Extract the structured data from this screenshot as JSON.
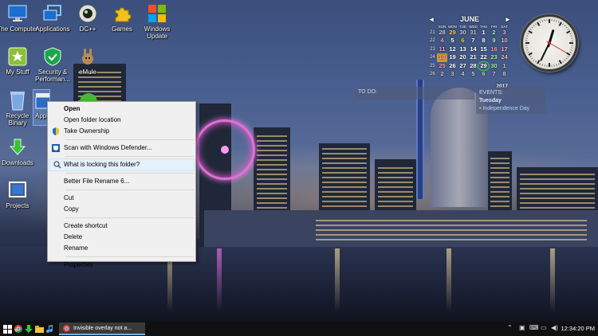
{
  "desktop_icons": [
    {
      "label": "The Computer",
      "icon": "computer-icon"
    },
    {
      "label": "Applications",
      "icon": "windows-folder-icon"
    },
    {
      "label": "DC++",
      "icon": "dcpp-icon"
    },
    {
      "label": "Games",
      "icon": "puzzle-icon"
    },
    {
      "label": "Windows Update",
      "icon": "windows-update-icon"
    },
    {
      "label": "My Stuff",
      "icon": "star-folder-icon"
    },
    {
      "label": "Security & Performan...",
      "icon": "shield-check-icon"
    },
    {
      "label": "eMule",
      "icon": "emule-mule-icon"
    },
    {
      "label": "Recycle Binary",
      "icon": "recycle-bin-icon"
    },
    {
      "label": "Appl",
      "icon": "clapper-icon"
    },
    {
      "label": "Downloads",
      "icon": "download-arrow-icon"
    },
    {
      "label": "Projects",
      "icon": "projects-icon"
    }
  ],
  "calendar": {
    "month": "JUNE",
    "year": "2017",
    "weekdays": [
      "SUN",
      "MON",
      "TUE",
      "WED",
      "THU",
      "FRI",
      "SAT"
    ],
    "weeks": [
      [
        "28",
        "29",
        "30",
        "31",
        "1",
        "2",
        "3"
      ],
      [
        "4",
        "5",
        "6",
        "7",
        "8",
        "9",
        "10"
      ],
      [
        "11",
        "12",
        "13",
        "14",
        "15",
        "16",
        "17"
      ],
      [
        "18",
        "19",
        "20",
        "21",
        "22",
        "23",
        "24"
      ],
      [
        "25",
        "26",
        "27",
        "28",
        "29",
        "30",
        "1"
      ],
      [
        "2",
        "3",
        "4",
        "5",
        "6",
        "7",
        "8"
      ]
    ],
    "week_numbers": [
      "21",
      "22",
      "23",
      "24",
      "25",
      "26"
    ],
    "today": "29",
    "prev": "◂",
    "next": "▸"
  },
  "clock": {
    "hour": 12,
    "minute": 34,
    "second": 20
  },
  "todo": {
    "label": "TO DO:"
  },
  "events": {
    "label": "EVENTS:",
    "day": "Tuesday",
    "item": "• Independence Day"
  },
  "context_menu": {
    "items": [
      {
        "label": "Open",
        "bold": true,
        "icon": ""
      },
      {
        "label": "Open folder location",
        "icon": ""
      },
      {
        "label": "Take Ownership",
        "icon": "uac-shield-icon"
      },
      {
        "sep": true
      },
      {
        "label": "Scan with Windows Defender...",
        "icon": "defender-icon"
      },
      {
        "sep": true
      },
      {
        "label": "What is locking this folder?",
        "icon": "magnifier-icon",
        "highlight": true
      },
      {
        "sep": true
      },
      {
        "label": "Better File Rename 6...",
        "icon": ""
      },
      {
        "sep": true
      },
      {
        "label": "Cut",
        "icon": ""
      },
      {
        "label": "Copy",
        "icon": ""
      },
      {
        "sep": true
      },
      {
        "label": "Create shortcut",
        "icon": ""
      },
      {
        "label": "Delete",
        "icon": ""
      },
      {
        "label": "Rename",
        "icon": ""
      },
      {
        "sep": true
      },
      {
        "label": "Properties",
        "icon": ""
      }
    ]
  },
  "taskbar": {
    "active_task": "Invisible overlay not a...",
    "clock": "12:34:20 PM",
    "colors": {
      "bg": "#101010",
      "accent": "#7aaee0"
    }
  }
}
